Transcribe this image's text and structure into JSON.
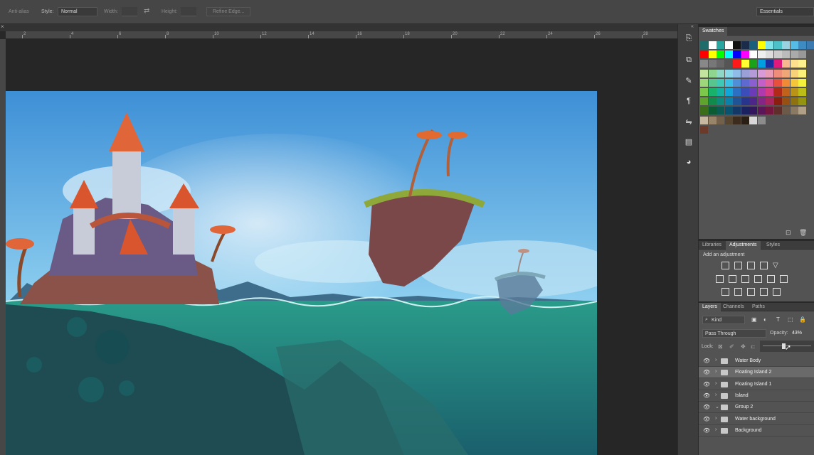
{
  "options_bar": {
    "anti_alias": "Anti-alias",
    "style_label": "Style:",
    "style_value": "Normal",
    "width_label": "Width:",
    "height_label": "Height:",
    "refine_edge": "Refine Edge...",
    "workspace": "Essentials"
  },
  "ruler": {
    "ticks": [
      "2",
      "4",
      "6",
      "8",
      "10",
      "12",
      "14",
      "16",
      "18",
      "20",
      "22",
      "24",
      "26",
      "28",
      "30"
    ]
  },
  "swatches": {
    "tab": "Swatches",
    "colors": [
      [
        "#1f6c6b",
        "#ffffff",
        "#2aa6a0",
        "#ffffff",
        "#111111",
        "#1b2c4b",
        "#1a5f7c",
        "#ffff00",
        "#7fe3e9",
        "#4dc1c8",
        "#9bd2e0",
        "#55bde5",
        "#3d8bc2",
        "#3b7bb2"
      ],
      [
        "#ff0000",
        "#ffff00",
        "#00ff00",
        "#00ffff",
        "#0000ff",
        "#ff00ff",
        "#ffffff",
        "#eeeeee",
        "#dddddd",
        "#cccccc",
        "#bbbbbb",
        "#aaaaaa",
        "#999999"
      ],
      [
        "#888888",
        "#777777",
        "#666666",
        "#555555",
        "#ff1a1a",
        "#ffff33",
        "#1aa31a",
        "#00a0e0",
        "#1c2e9b",
        "#e0197d",
        "#f7b78f",
        "#fde08d",
        "#fff08f"
      ],
      [
        "#c2e49e",
        "#8fd48f",
        "#8fd8c8",
        "#8bd8e8",
        "#8fbde8",
        "#9b9fd8",
        "#b49bd8",
        "#d89bd8",
        "#e89bb4",
        "#ee8e7a",
        "#f0a778",
        "#f7d27a",
        "#fbf07a"
      ],
      [
        "#9ed77a",
        "#57c68e",
        "#3ec8b8",
        "#3bc0e6",
        "#4f8fd8",
        "#5f6ad0",
        "#8b5fd0",
        "#c35fc8",
        "#e25f9a",
        "#e6503c",
        "#f08a34",
        "#f5c53a",
        "#f5f03a"
      ],
      [
        "#7cc84a",
        "#18b26a",
        "#14b0a0",
        "#11a6d8",
        "#2c70c4",
        "#3b4db8",
        "#6c3cb8",
        "#ae3aae",
        "#d63a80",
        "#b12a18",
        "#c0621a",
        "#b89318",
        "#bdbd18"
      ],
      [
        "#5fa22e",
        "#118a4c",
        "#0e8a7c",
        "#0b80a8",
        "#1f5497",
        "#27358c",
        "#4e2589",
        "#852585",
        "#a8255f",
        "#8a1f10",
        "#955012",
        "#8f7210",
        "#949410"
      ],
      [
        "#3c6e1a",
        "#0c5c33",
        "#0a5c52",
        "#085470",
        "#133767",
        "#1a2260",
        "#33175c",
        "#5a1659",
        "#731640",
        "#5e2f2a",
        "#6b5a48",
        "#8a7a64",
        "#b0a088"
      ],
      [
        "#c7b8a2",
        "#988468",
        "#73604a",
        "#56452f",
        "#3b2c1e",
        "#2a1f14",
        "#d8d8d8",
        "#8c8c8c"
      ],
      [
        "#6b3a2a"
      ]
    ]
  },
  "adjustments": {
    "tabs": [
      "Libraries",
      "Adjustments",
      "Styles"
    ],
    "add_label": "Add an adjustment"
  },
  "layers": {
    "tabs": [
      "Layers",
      "Channels",
      "Paths"
    ],
    "filter_kind": "Kind",
    "blend_mode": "Pass Through",
    "opacity_label": "Opacity:",
    "opacity_value": "43%",
    "lock_label": "Lock:",
    "opacity_slider_fraction": 0.43,
    "items": [
      {
        "name": "Water Body",
        "selected": false,
        "open": false
      },
      {
        "name": "Floating Island 2",
        "selected": true,
        "open": false
      },
      {
        "name": "Floating Island 1",
        "selected": false,
        "open": false
      },
      {
        "name": "Island",
        "selected": false,
        "open": false
      },
      {
        "name": "Group 2",
        "selected": false,
        "open": true
      },
      {
        "name": "Water background",
        "selected": false,
        "open": false
      },
      {
        "name": "Background",
        "selected": false,
        "open": false
      }
    ]
  }
}
